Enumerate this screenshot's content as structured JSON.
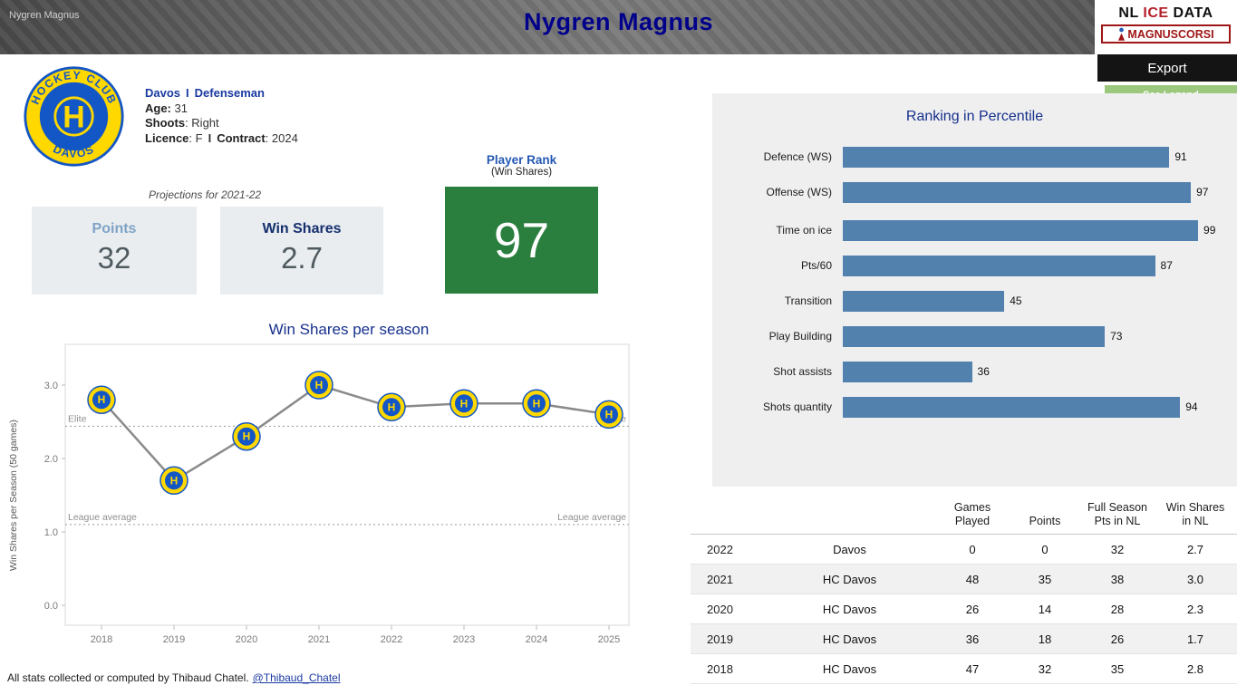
{
  "window": {
    "label": "Nygren Magnus"
  },
  "header": {
    "title": "Nygren Magnus",
    "brand": {
      "line1": [
        "NL",
        "ICE",
        "DATA"
      ],
      "line2": "MAGNUSCORSI"
    },
    "export_label": "Export",
    "see_legend_label": "See Legend"
  },
  "club_logo": {
    "top": "HOCKEY CLUB",
    "bottom": "DAVOS",
    "letter": "H"
  },
  "player": {
    "team": "Davos",
    "separator": "I",
    "position": "Defenseman",
    "age_label": "Age:",
    "age_value": "31",
    "shoots_label": "Shoots",
    "shoots_value": ": Right",
    "licence_label": "Licence",
    "licence_value": ": F",
    "contract_label": "Contract",
    "contract_value": ": 2024"
  },
  "projections": {
    "heading": "Projections for 2021-22",
    "points": {
      "label": "Points",
      "value": "32"
    },
    "win_shares": {
      "label": "Win Shares",
      "value": "2.7"
    },
    "player_rank": {
      "label1": "Player Rank",
      "label2": "(Win Shares)",
      "value": "97"
    }
  },
  "chart_data": [
    {
      "type": "line",
      "title": "Win Shares per season",
      "x": [
        2018,
        2019,
        2020,
        2021,
        2022,
        2023,
        2024,
        2025
      ],
      "values": [
        2.8,
        1.7,
        2.3,
        3.0,
        2.7,
        2.75,
        2.75,
        2.6
      ],
      "ylabel": "Win Shares per Season (50 games)",
      "yticks": [
        0.0,
        1.0,
        2.0,
        3.0
      ],
      "ylim": [
        -0.3,
        3.5
      ],
      "grid": false,
      "marker": "hc-davos-logo",
      "line_color": "#8a8a8a",
      "reference_lines": [
        {
          "label": "Elite",
          "value": 2.44
        },
        {
          "label": "League average",
          "value": 1.1
        }
      ]
    },
    {
      "type": "bar",
      "title": "Ranking in Percentile",
      "orientation": "horizontal",
      "categories": [
        "Defence (WS)",
        "Offense (WS)",
        "Time on ice",
        "Pts/60",
        "Transition",
        "Play Building",
        "Shot assists",
        "Shots quantity"
      ],
      "values": [
        91,
        97,
        99,
        87,
        45,
        73,
        36,
        94
      ],
      "xlim": [
        0,
        100
      ],
      "bar_color": "#5381ad",
      "group_break_after_index": 1,
      "value_labels": true
    }
  ],
  "history_table": {
    "headers": [
      "",
      "",
      "Games\nPlayed",
      "Points",
      "Full Season\nPts in NL",
      "Win Shares\nin NL"
    ],
    "rows": [
      {
        "year": "2022",
        "team": "Davos",
        "games": "0",
        "points": "0",
        "full_season": "32",
        "win_shares": "2.7"
      },
      {
        "year": "2021",
        "team": "HC Davos",
        "games": "48",
        "points": "35",
        "full_season": "38",
        "win_shares": "3.0"
      },
      {
        "year": "2020",
        "team": "HC Davos",
        "games": "26",
        "points": "14",
        "full_season": "28",
        "win_shares": "2.3"
      },
      {
        "year": "2019",
        "team": "HC Davos",
        "games": "36",
        "points": "18",
        "full_season": "26",
        "win_shares": "1.7"
      },
      {
        "year": "2018",
        "team": "HC Davos",
        "games": "47",
        "points": "32",
        "full_season": "35",
        "win_shares": "2.8"
      }
    ]
  },
  "footer": {
    "text": "All stats collected or computed by Thibaud Chatel.",
    "link": "@Thibaud_Chatel"
  },
  "colors": {
    "title_navy": "#00008b",
    "accent_navy": "#16308c",
    "bar_blue": "#5381ad",
    "rank_green": "#2a7e3e",
    "legend_green": "#9cc87d",
    "panel_gray": "#efeff0",
    "card_gray": "#e9edf0",
    "davos_blue": "#1356c5",
    "davos_yellow": "#ffd800"
  }
}
